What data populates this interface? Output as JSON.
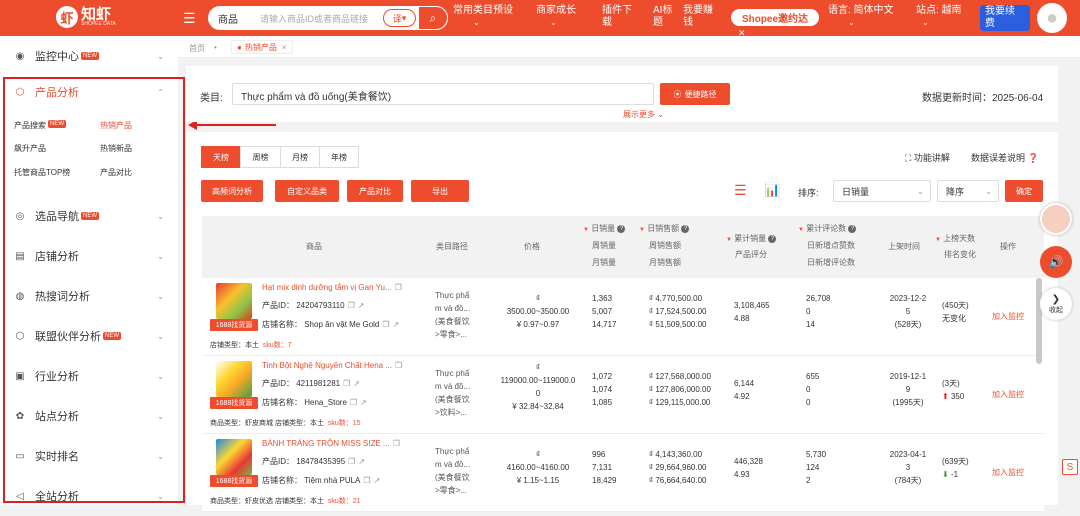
{
  "header": {
    "logo_mark": "虾",
    "logo_name": "知虾",
    "logo_sub": "SHOPEE DATA",
    "search_category": "商品",
    "search_placeholder": "请输入商品ID或者商品链接",
    "search_mode": "译",
    "nav": [
      {
        "label": "常用类目预设"
      },
      {
        "label": "商家成长"
      },
      {
        "label": "插件下\n载"
      },
      {
        "label": "AI标\n题"
      },
      {
        "label": "我要赚\n钱"
      }
    ],
    "promo": "Shopee邀约达",
    "language": "语言: 简体中文",
    "site": "站点: 越南",
    "renew": "我要续\n费"
  },
  "sidebar": {
    "items": [
      {
        "label": "监控中心",
        "badge": "NEW",
        "icon": "monitor-icon"
      },
      {
        "label": "产品分析",
        "icon": "cube-icon",
        "active": true
      },
      {
        "label": "选品导航",
        "badge": "NEW",
        "icon": "compass-icon"
      },
      {
        "label": "店铺分析",
        "icon": "store-icon"
      },
      {
        "label": "热搜词分析",
        "icon": "hot-icon"
      },
      {
        "label": "联盟伙伴分析",
        "badge": "NEW",
        "icon": "partner-icon"
      },
      {
        "label": "行业分析",
        "icon": "industry-icon"
      },
      {
        "label": "站点分析",
        "icon": "site-icon"
      },
      {
        "label": "实时排名",
        "icon": "rank-icon"
      },
      {
        "label": "全站分析",
        "icon": "global-icon"
      }
    ],
    "sub_items": [
      {
        "label": "产品搜索",
        "badge": "NEW"
      },
      {
        "label": "热销产品",
        "active": true
      },
      {
        "label": "飙升产品"
      },
      {
        "label": "热销新品"
      },
      {
        "label": "托管商品TOP榜"
      },
      {
        "label": "产品对比"
      }
    ]
  },
  "tabs": {
    "home": "首页",
    "active": "热销产品"
  },
  "filter": {
    "category_label": "类目:",
    "category_value": "Thực phẩm và đồ uống(美食餐饮)",
    "quick_path": "便捷路径",
    "more": "展示更多",
    "update_time": "数据更新时间：2025-06-04"
  },
  "toolbar": {
    "periods": [
      "天榜",
      "周榜",
      "月榜",
      "年榜"
    ],
    "feature_help": "功能讲解",
    "data_error": "数据误差说明",
    "actions": [
      "高频词分析",
      "自定义品类",
      "产品对比",
      "导出"
    ],
    "sort_label": "排序:",
    "sort_field": "日销量",
    "sort_order": "降序",
    "confirm": "确定"
  },
  "table": {
    "headers": {
      "product": "商品",
      "category_path": "类目路径",
      "price": "价格",
      "daily_sales": "日销量",
      "weekly_sales": "周销量",
      "monthly_sales": "月销量",
      "daily_revenue": "日销售额",
      "weekly_revenue": "周销售额",
      "monthly_revenue": "月销售额",
      "total_sales": "累计销量",
      "rating": "产品评分",
      "total_reviews": "累计评论数",
      "daily_likes": "日新增点赞数",
      "daily_reviews": "日新增评论数",
      "listed_time": "上架时间",
      "days_on_list": "上榜天数",
      "rank_change": "排名变化",
      "operation": "操作"
    },
    "rows": [
      {
        "name": "Hạt mix dinh dưỡng tắm vị Gan Yu...",
        "product_id": "产品ID： 24204793110",
        "store": "店铺名称： Shop ăn vặt Mẹ Gold",
        "tag": "1688找货源",
        "store_type": "店铺类型：本土",
        "sku": "sku数：7",
        "category": [
          "Thực phẩ",
          "m và đồ...",
          "(美食餐饮",
          ">零食>..."
        ],
        "price": [
          "₫",
          "3500.00~3500.00",
          "¥ 0.97~0.97"
        ],
        "sales": [
          "1,363",
          "5,007",
          "14,717"
        ],
        "revenue": [
          "₫ 4,770,500.00",
          "₫ 17,524,500.00",
          "₫ 51,509,500.00"
        ],
        "total": [
          "3,108,465",
          "4.88"
        ],
        "reviews": [
          "26,708",
          "0",
          "14"
        ],
        "listed": [
          "2023-12-2",
          "5",
          "(528天)"
        ],
        "rank": [
          "(450天)",
          "无变化"
        ],
        "rank_dir": "none",
        "action": "加入监控"
      },
      {
        "name": "Tinh Bột Nghệ Nguyên Chất Hena ...",
        "product_id": "产品ID： 4211981281",
        "store": "店铺名称： Hena_Store",
        "tag": "1688找货源",
        "store_type": "商品类型：虾皮商城   店铺类型：本土",
        "sku": "sku数：15",
        "category": [
          "Thực phẩ",
          "m và đồ...",
          "(美食餐饮",
          ">饮料>..."
        ],
        "price": [
          "₫",
          "119000.00~119000.0",
          "0",
          "¥ 32.84~32.84"
        ],
        "sales": [
          "1,072",
          "1,074",
          "1,085"
        ],
        "revenue": [
          "₫ 127,568,000.00",
          "₫ 127,806,000.00",
          "₫ 129,115,000.00"
        ],
        "total": [
          "6,144",
          "4.92"
        ],
        "reviews": [
          "655",
          "0",
          "0"
        ],
        "listed": [
          "2019-12-1",
          "9",
          "(1995天)"
        ],
        "rank": [
          "(3天)",
          "350"
        ],
        "rank_dir": "up",
        "action": "加入监控"
      },
      {
        "name": "BÁNH TRÁNG TRỘN MISS SIZE ...",
        "product_id": "产品ID： 18478435395",
        "store": "店铺名称： Tiệm nhà PULA",
        "tag": "1688找货源",
        "store_type": "商品类型：虾皮优选   店铺类型：本土",
        "sku": "sku数：21",
        "category": [
          "Thực phẩ",
          "m và đồ...",
          "(美食餐饮",
          ">零食>..."
        ],
        "price": [
          "₫",
          "4160.00~4160.00",
          "¥ 1.15~1.15"
        ],
        "sales": [
          "996",
          "7,131",
          "18,429"
        ],
        "revenue": [
          "₫ 4,143,360.00",
          "₫ 29,664,960.00",
          "₫ 76,664,640.00"
        ],
        "total": [
          "446,328",
          "4.93"
        ],
        "reviews": [
          "5,730",
          "124",
          "2"
        ],
        "listed": [
          "2023-04-1",
          "3",
          "(784天)"
        ],
        "rank": [
          "(639天)",
          "-1"
        ],
        "rank_dir": "down",
        "action": "加入监控"
      }
    ]
  },
  "float": {
    "collapse": "收起"
  },
  "colors": {
    "brand": "#ee4d2d",
    "highlight_box": "#e02020"
  }
}
